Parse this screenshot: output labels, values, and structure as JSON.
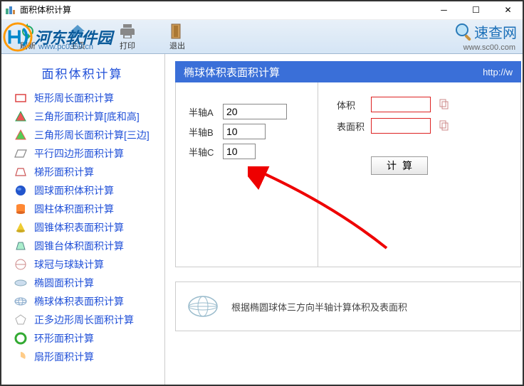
{
  "window": {
    "title": "面积体积计算"
  },
  "toolbar": {
    "refresh": "刷新",
    "home": "主页",
    "print": "打印",
    "exit": "退出"
  },
  "brand": {
    "siteName": "河东软件园",
    "siteUrl": "www.pc0359.cn",
    "searchName": "速查网",
    "searchUrl": "www.sc00.com"
  },
  "sidebar": {
    "title": "面积体积计算",
    "items": [
      "矩形周长面积计算",
      "三角形面积计算[底和高]",
      "三角形周长面积计算[三边]",
      "平行四边形面积计算",
      "梯形面积计算",
      "圆球面积体积计算",
      "圆柱体积面积计算",
      "圆锥体积表面积计算",
      "圆锥台体积面积计算",
      "球冠与球缺计算",
      "椭圆面积计算",
      "椭球体积表面积计算",
      "正多边形周长面积计算",
      "环形面积计算",
      "扇形面积计算"
    ]
  },
  "panel": {
    "title": "椭球体积表面积计算",
    "url": "http://w",
    "axisA": "半轴A",
    "axisB": "半轴B",
    "axisC": "半轴C",
    "valA": "20",
    "valB": "10",
    "valC": "10",
    "volume": "体积",
    "surface": "表面积",
    "calc": "计算",
    "desc": "根据椭圆球体三方向半轴计算体积及表面积"
  }
}
